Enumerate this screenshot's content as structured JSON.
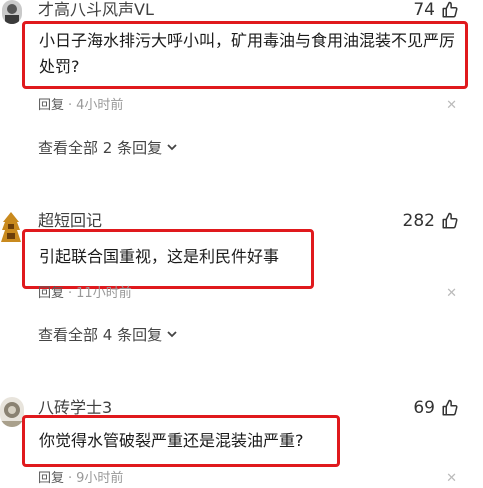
{
  "comments": [
    {
      "username": "才高八斗风声VL",
      "likes": "74",
      "text": "小日子海水排污大呼小叫，矿用毒油与食用油混装不见严厉处罚?",
      "reply_label": "回复",
      "time": "4小时前",
      "view_all": "查看全部 2 条回复"
    },
    {
      "username": "超短回记",
      "likes": "282",
      "text": "引起联合国重视，这是利民件好事",
      "reply_label": "回复",
      "time": "11小时前",
      "view_all": "查看全部 4 条回复"
    },
    {
      "username": "八砖学士3",
      "likes": "69",
      "text": "你觉得水管破裂严重还是混装油严重?",
      "reply_label": "回复",
      "time": "9小时前"
    }
  ],
  "icons": {
    "like": "thumbs-up-icon",
    "dismiss": "close-icon",
    "expand": "chevron-down-icon"
  },
  "colors": {
    "highlight_border": "#e0191d"
  }
}
